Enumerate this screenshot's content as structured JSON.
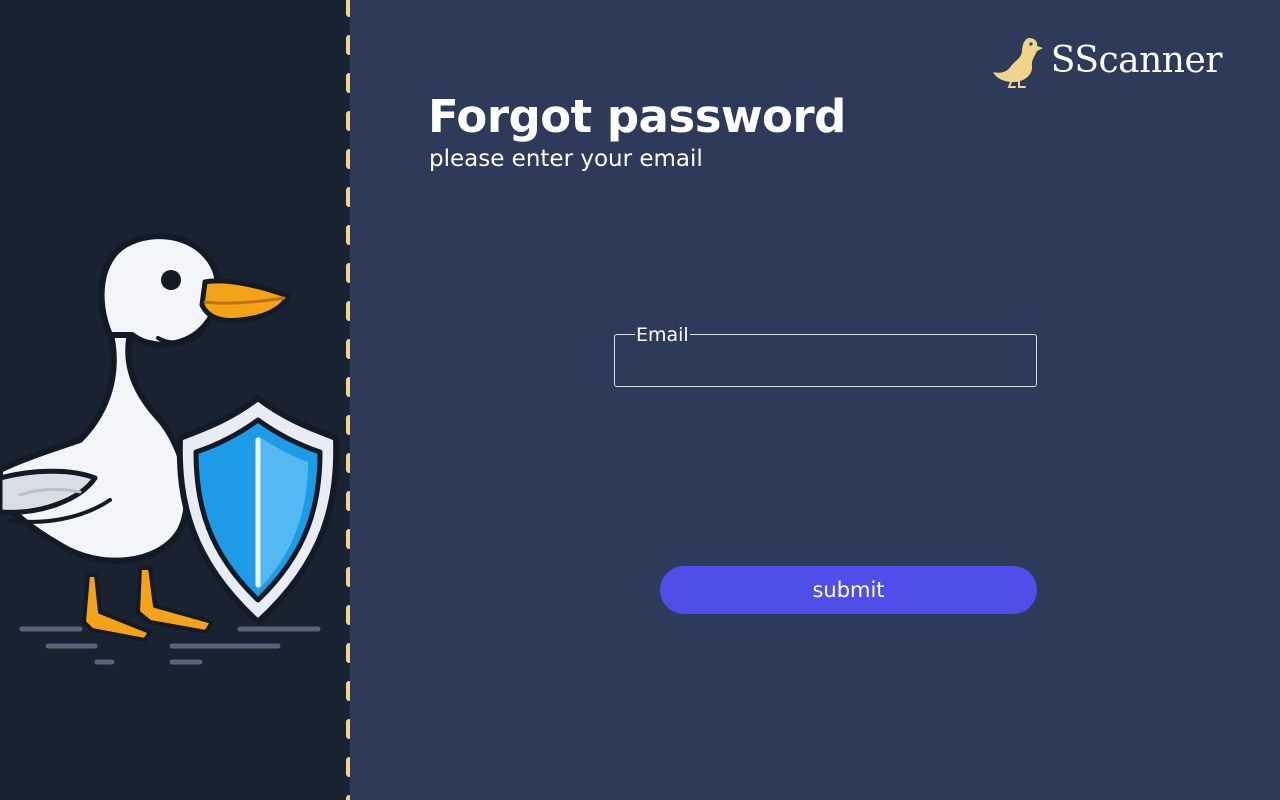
{
  "brand": {
    "name": "SScanner",
    "logo_icon": "duck-icon",
    "logo_color": "#f0d48a"
  },
  "form": {
    "title": "Forgot password",
    "subtitle": "please enter your email",
    "email": {
      "label": "Email",
      "value": "",
      "placeholder": ""
    },
    "submit_label": "submit"
  },
  "illustration": {
    "icon": "duck-with-shield-illustration"
  },
  "colors": {
    "left_background": "#182230",
    "right_background": "#2e3a5a",
    "accent": "#4f4ee8",
    "divider": "#f0d48a"
  }
}
